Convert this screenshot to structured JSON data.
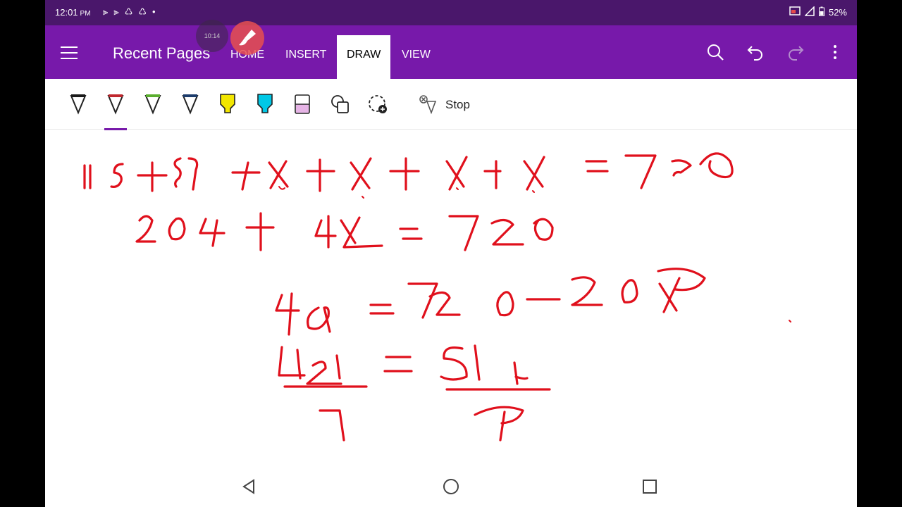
{
  "status_bar": {
    "time": "12:01",
    "ampm": "PM",
    "battery": "52%",
    "icons": [
      "notification-icon",
      "notification-icon",
      "recycle-icon",
      "recycle-icon",
      "dot-icon"
    ]
  },
  "app_bar": {
    "title": "Recent Pages",
    "timer_text": "10:14",
    "tabs": [
      {
        "label": "HOME",
        "active": false
      },
      {
        "label": "INSERT",
        "active": false
      },
      {
        "label": "DRAW",
        "active": true
      },
      {
        "label": "VIEW",
        "active": false
      }
    ],
    "icons": [
      "menu-icon",
      "search-icon",
      "undo-icon",
      "redo-icon",
      "more-icon"
    ]
  },
  "toolbar": {
    "pens": [
      {
        "name": "pen-black",
        "color": "#1a1a1a"
      },
      {
        "name": "pen-red",
        "color": "#c0282e"
      },
      {
        "name": "pen-green",
        "color": "#5aae2e"
      },
      {
        "name": "pen-navy",
        "color": "#1c3c6c"
      },
      {
        "name": "highlighter-yellow",
        "color": "#f2e600"
      },
      {
        "name": "highlighter-cyan",
        "color": "#00c8e6"
      },
      {
        "name": "highlighter-pink",
        "color": "#e6b4e6"
      }
    ],
    "stop_label": "Stop"
  },
  "colors": {
    "status_bar": "#4a176b",
    "app_bar": "#7719aa",
    "ink": "#e0101c"
  },
  "handwriting": {
    "line1": "115+89+x+x+x+x = 720",
    "line2": "204 + 4x = 720",
    "line3": "4x = 720 - 204",
    "line4_lhs": "4x / 4",
    "line4_rhs": "516 / 4"
  },
  "nav_bar": {
    "icons": [
      "back-icon",
      "home-icon",
      "recents-icon"
    ]
  }
}
